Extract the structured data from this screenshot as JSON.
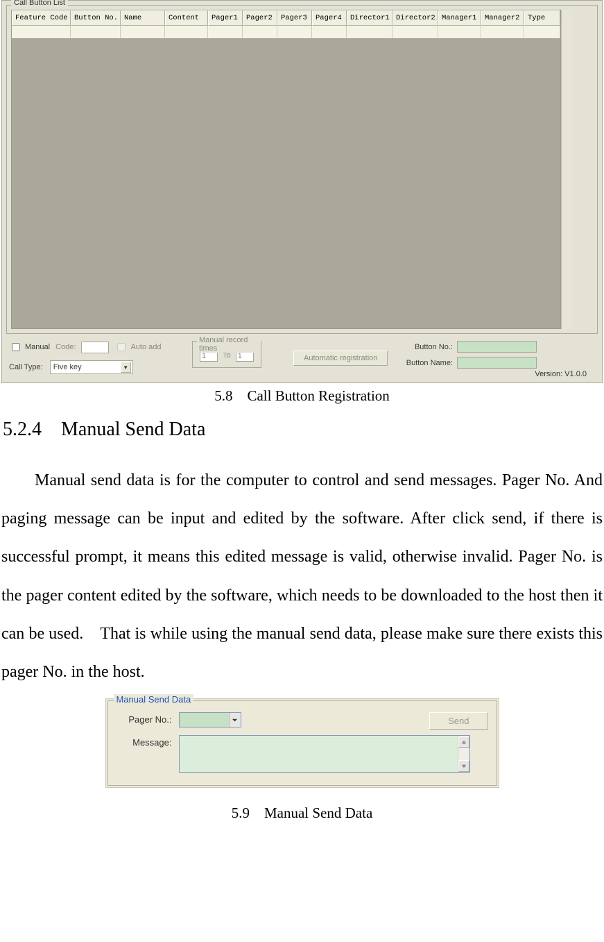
{
  "captions": {
    "fig58": "5.8 Call Button Registration",
    "fig59": "5.9 Manual Send Data"
  },
  "heading": "5.2.4 Manual Send Data",
  "paragraph": "Manual send data is for the computer to control and send messages. Pager No. And paging message can be input and edited by the software. After click send, if there is successful prompt, it means this edited message is valid, otherwise invalid. Pager No. is the pager content edited by the software, which needs to be downloaded to the host then it can be used. That is while using the manual send data, please make sure there exists this pager No. in the host.",
  "fig58": {
    "group_title": "Call Button List",
    "columns": [
      "Feature Code",
      "Button No.",
      "Name",
      "Content",
      "Pager1",
      "Pager2",
      "Pager3",
      "Pager4",
      "Director1",
      "Director2",
      "Manager1",
      "Manager2",
      "Type"
    ],
    "labels": {
      "manual": "Manual",
      "code": "Code:",
      "auto_add": "Auto add",
      "call_type": "Call Type:",
      "manual_record_times": "Manual record times",
      "to": "To",
      "auto_reg": "Automatic registration",
      "button_no": "Button No.:",
      "button_name": "Button Name:",
      "version": "Version: V1.0.0"
    },
    "values": {
      "code": "",
      "call_type": "Five  key",
      "rec_from": "1",
      "rec_to": "1",
      "button_no": "",
      "button_name": ""
    }
  },
  "fig59": {
    "group_title": "Manual Send Data",
    "labels": {
      "pager_no": "Pager No.:",
      "message": "Message:",
      "send": "Send"
    },
    "values": {
      "pager_no": "",
      "message": ""
    }
  }
}
